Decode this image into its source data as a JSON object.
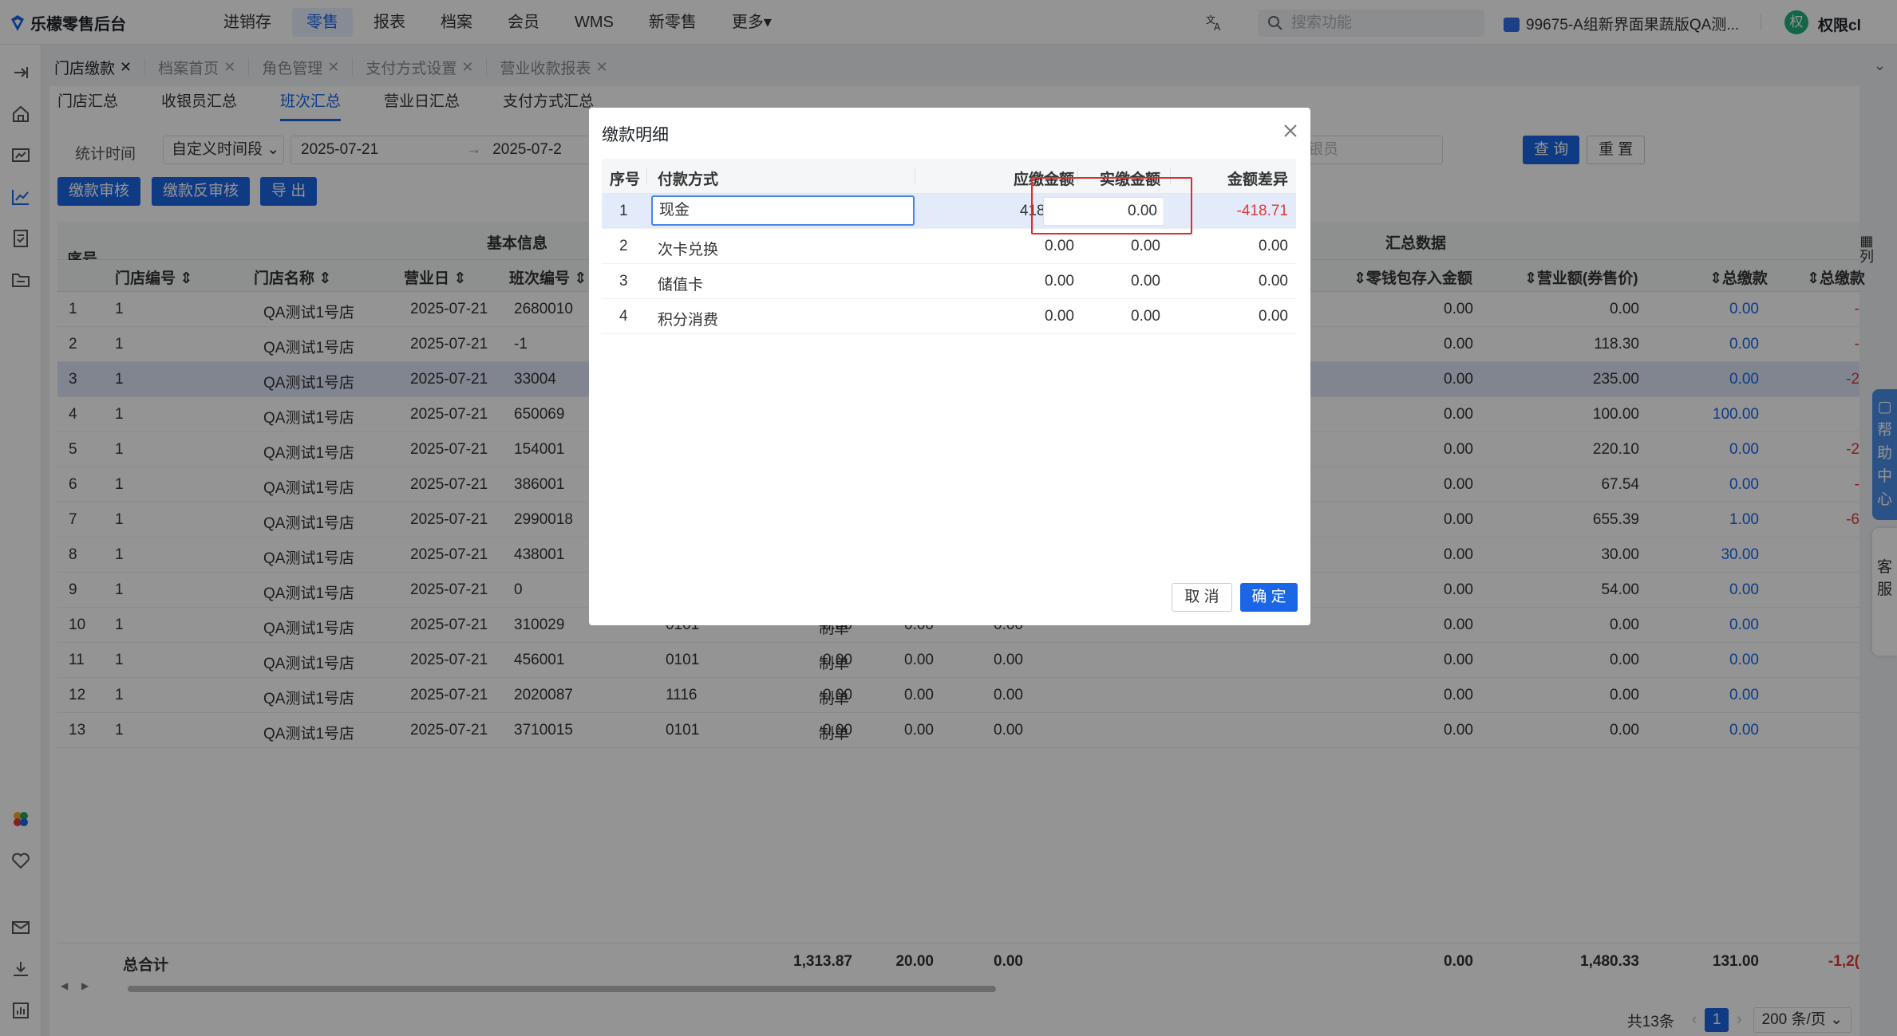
{
  "app": {
    "title": "乐檬零售后台"
  },
  "topnav": [
    {
      "label": "进销存"
    },
    {
      "label": "零售",
      "active": true
    },
    {
      "label": "报表"
    },
    {
      "label": "档案"
    },
    {
      "label": "会员"
    },
    {
      "label": "WMS"
    },
    {
      "label": "新零售"
    },
    {
      "label": "更多▾"
    }
  ],
  "header": {
    "search_placeholder": "搜索功能",
    "store": "99675-A组新界面果蔬版QA测...",
    "avatar_letter": "权",
    "user": "权限cl"
  },
  "page_tabs": [
    {
      "label": "门店缴款",
      "active": true
    },
    {
      "label": "档案首页"
    },
    {
      "label": "角色管理"
    },
    {
      "label": "支付方式设置"
    },
    {
      "label": "营业收款报表"
    }
  ],
  "sub_tabs": [
    {
      "label": "门店汇总"
    },
    {
      "label": "收银员汇总"
    },
    {
      "label": "班次汇总",
      "active": true
    },
    {
      "label": "营业日汇总"
    },
    {
      "label": "支付方式汇总"
    }
  ],
  "filters": {
    "time_label": "统计时间",
    "time_mode": "自定义时间段",
    "start_date": "2025-07-21",
    "end_date": "2025-07-2",
    "cashier_placeholder": "银员",
    "query": "查 询",
    "reset": "重 置"
  },
  "actions": {
    "audit": "缴款审核",
    "unaudit": "缴款反审核",
    "export": "导 出"
  },
  "table": {
    "group_basic": "基本信息",
    "group_summary": "汇总数据",
    "col_index": "序号",
    "col_store_no": "门店编号",
    "col_store_name": "门店名称",
    "col_bizday": "营业日",
    "col_shift": "班次编号",
    "col_wallet": "零钱包存入金额",
    "col_revenue": "营业额(券售价)",
    "col_total_paid": "总缴款",
    "col_total_diff": "总缴款",
    "rows": [
      {
        "idx": "1",
        "store_no": "1",
        "store_name": "QA测试1号店",
        "bizday": "2025-07-21",
        "shift": "2680010",
        "cashier": "",
        "status": "",
        "a": "",
        "b": "",
        "c": "",
        "wallet": "0.00",
        "revenue": "0.00",
        "paid": "0.00",
        "diff": "-"
      },
      {
        "idx": "2",
        "store_no": "1",
        "store_name": "QA测试1号店",
        "bizday": "2025-07-21",
        "shift": "-1",
        "cashier": "",
        "status": "",
        "a": "",
        "b": "",
        "c": "",
        "wallet": "0.00",
        "revenue": "118.30",
        "paid": "0.00",
        "diff": "-"
      },
      {
        "idx": "3",
        "store_no": "1",
        "store_name": "QA测试1号店",
        "bizday": "2025-07-21",
        "shift": "33004",
        "cashier": "",
        "status": "",
        "a": "",
        "b": "",
        "c": "",
        "wallet": "0.00",
        "revenue": "235.00",
        "paid": "0.00",
        "diff": "-2",
        "selected": true
      },
      {
        "idx": "4",
        "store_no": "1",
        "store_name": "QA测试1号店",
        "bizday": "2025-07-21",
        "shift": "650069",
        "cashier": "",
        "status": "",
        "a": "",
        "b": "",
        "c": "",
        "wallet": "0.00",
        "revenue": "100.00",
        "paid": "100.00",
        "diff": ""
      },
      {
        "idx": "5",
        "store_no": "1",
        "store_name": "QA测试1号店",
        "bizday": "2025-07-21",
        "shift": "154001",
        "cashier": "",
        "status": "",
        "a": "",
        "b": "",
        "c": "",
        "wallet": "0.00",
        "revenue": "220.10",
        "paid": "0.00",
        "diff": "-2"
      },
      {
        "idx": "6",
        "store_no": "1",
        "store_name": "QA测试1号店",
        "bizday": "2025-07-21",
        "shift": "386001",
        "cashier": "",
        "status": "",
        "a": "",
        "b": "",
        "c": "",
        "wallet": "0.00",
        "revenue": "67.54",
        "paid": "0.00",
        "diff": "-"
      },
      {
        "idx": "7",
        "store_no": "1",
        "store_name": "QA测试1号店",
        "bizday": "2025-07-21",
        "shift": "2990018",
        "cashier": "",
        "status": "",
        "a": "",
        "b": "",
        "c": "",
        "wallet": "0.00",
        "revenue": "655.39",
        "paid": "1.00",
        "diff": "-6"
      },
      {
        "idx": "8",
        "store_no": "1",
        "store_name": "QA测试1号店",
        "bizday": "2025-07-21",
        "shift": "438001",
        "cashier": "",
        "status": "",
        "a": "",
        "b": "",
        "c": "",
        "wallet": "0.00",
        "revenue": "30.00",
        "paid": "30.00",
        "diff": ""
      },
      {
        "idx": "9",
        "store_no": "1",
        "store_name": "QA测试1号店",
        "bizday": "2025-07-21",
        "shift": "0",
        "cashier": "",
        "status": "",
        "a": "",
        "b": "",
        "c": "",
        "wallet": "0.00",
        "revenue": "54.00",
        "paid": "0.00",
        "diff": ""
      },
      {
        "idx": "10",
        "store_no": "1",
        "store_name": "QA测试1号店",
        "bizday": "2025-07-21",
        "shift": "310029",
        "cashier": "0101",
        "status": "制单",
        "a": "0.00",
        "b": "0.00",
        "c": "0.00",
        "wallet": "0.00",
        "revenue": "0.00",
        "paid": "0.00",
        "diff": ""
      },
      {
        "idx": "11",
        "store_no": "1",
        "store_name": "QA测试1号店",
        "bizday": "2025-07-21",
        "shift": "456001",
        "cashier": "0101",
        "status": "制单",
        "a": "0.00",
        "b": "0.00",
        "c": "0.00",
        "wallet": "0.00",
        "revenue": "0.00",
        "paid": "0.00",
        "diff": ""
      },
      {
        "idx": "12",
        "store_no": "1",
        "store_name": "QA测试1号店",
        "bizday": "2025-07-21",
        "shift": "2020087",
        "cashier": "1116",
        "status": "制单",
        "a": "0.00",
        "b": "0.00",
        "c": "0.00",
        "wallet": "0.00",
        "revenue": "0.00",
        "paid": "0.00",
        "diff": ""
      },
      {
        "idx": "13",
        "store_no": "1",
        "store_name": "QA测试1号店",
        "bizday": "2025-07-21",
        "shift": "3710015",
        "cashier": "0101",
        "status": "制单",
        "a": "0.00",
        "b": "0.00",
        "c": "0.00",
        "wallet": "0.00",
        "revenue": "0.00",
        "paid": "0.00",
        "diff": ""
      }
    ],
    "total": {
      "label": "总合计",
      "a": "1,313.87",
      "b": "20.00",
      "c": "0.00",
      "wallet": "0.00",
      "revenue": "1,480.33",
      "paid": "131.00",
      "diff": "-1,2("
    }
  },
  "pagination": {
    "total": "共13条",
    "current": "1",
    "page_size": "200 条/页 ⌄"
  },
  "side": {
    "column_toggle": "列",
    "help": "帮助中心",
    "service": "客服"
  },
  "modal": {
    "title": "缴款明细",
    "col_index": "序号",
    "col_method": "付款方式",
    "col_due": "应缴金额",
    "col_actual": "实缴金额",
    "col_diff": "金额差异",
    "rows": [
      {
        "idx": "1",
        "method": "现金",
        "due": "418.71",
        "actual": "0.00",
        "diff": "-418.71"
      },
      {
        "idx": "2",
        "method": "次卡兑换",
        "due": "0.00",
        "actual": "0.00",
        "diff": "0.00"
      },
      {
        "idx": "3",
        "method": "储值卡",
        "due": "0.00",
        "actual": "0.00",
        "diff": "0.00"
      },
      {
        "idx": "4",
        "method": "积分消费",
        "due": "0.00",
        "actual": "0.00",
        "diff": "0.00"
      }
    ],
    "cancel": "取 消",
    "ok": "确 定"
  },
  "colors": {
    "primary": "#1a66e6",
    "negative": "#e03a3a",
    "highlight": "#e12a2a"
  }
}
